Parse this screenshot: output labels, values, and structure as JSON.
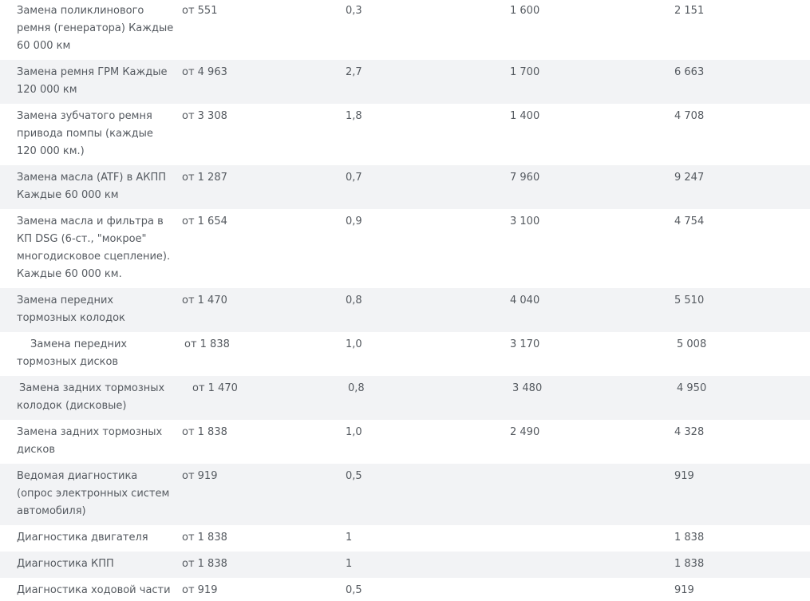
{
  "rows": [
    {
      "name": "Замена поликлинового ремня (генератора) Каждые 60 000 км",
      "price": "от 551",
      "hours": "0,3",
      "cost": "1 600",
      "total": "2 151"
    },
    {
      "name": "Замена ремня ГРМ Каждые 120 000 км",
      "price": "от 4 963",
      "hours": "2,7",
      "cost": "1 700",
      "total": "6 663"
    },
    {
      "name": "Замена зубчатого ремня привода помпы (каждые 120 000 км.)",
      "price": "от 3 308",
      "hours": "1,8",
      "cost": "1 400",
      "total": "4 708"
    },
    {
      "name": "Замена масла (ATF) в АКПП Каждые 60 000 км",
      "price": "от 1 287",
      "hours": "0,7",
      "cost": "7 960",
      "total": "9 247"
    },
    {
      "name": "Замена масла и фильтра в КП DSG (6-ст., \"мокрое\" многодисковое сцепление). Каждые 60 000 км.",
      "price": "от 1 654",
      "hours": "0,9",
      "cost": "3 100",
      "total": "4 754"
    },
    {
      "name": "Замена передних тормозных колодок",
      "price": "от 1 470",
      "hours": "0,8",
      "cost": "4 040",
      "total": "5 510"
    },
    {
      "name": "Замена передних тормозных дисков",
      "price": "от 1 838",
      "hours": "1,0",
      "cost": "3 170",
      "total": "5 008"
    },
    {
      "name": "Замена задних тормозных колодок (дисковые)",
      "price": "от 1 470",
      "hours": "0,8",
      "cost": "3 480",
      "total": "4 950"
    },
    {
      "name": "Замена задних тормозных дисков",
      "price": "от 1 838",
      "hours": "1,0",
      "cost": "2 490",
      "total": "4 328"
    },
    {
      "name": "Ведомая диагностика (опрос электронных систем автомобиля)",
      "price": "от 919",
      "hours": "0,5",
      "cost": "",
      "total": "919"
    },
    {
      "name": "Диагностика двигателя",
      "price": "от 1 838",
      "hours": "1",
      "cost": "",
      "total": "1 838"
    },
    {
      "name": "Диагностика КПП",
      "price": "от 1 838",
      "hours": "1",
      "cost": "",
      "total": "1 838"
    },
    {
      "name": "Диагностика ходовой части",
      "price": "от 919",
      "hours": "0,5",
      "cost": "",
      "total": "919"
    }
  ]
}
